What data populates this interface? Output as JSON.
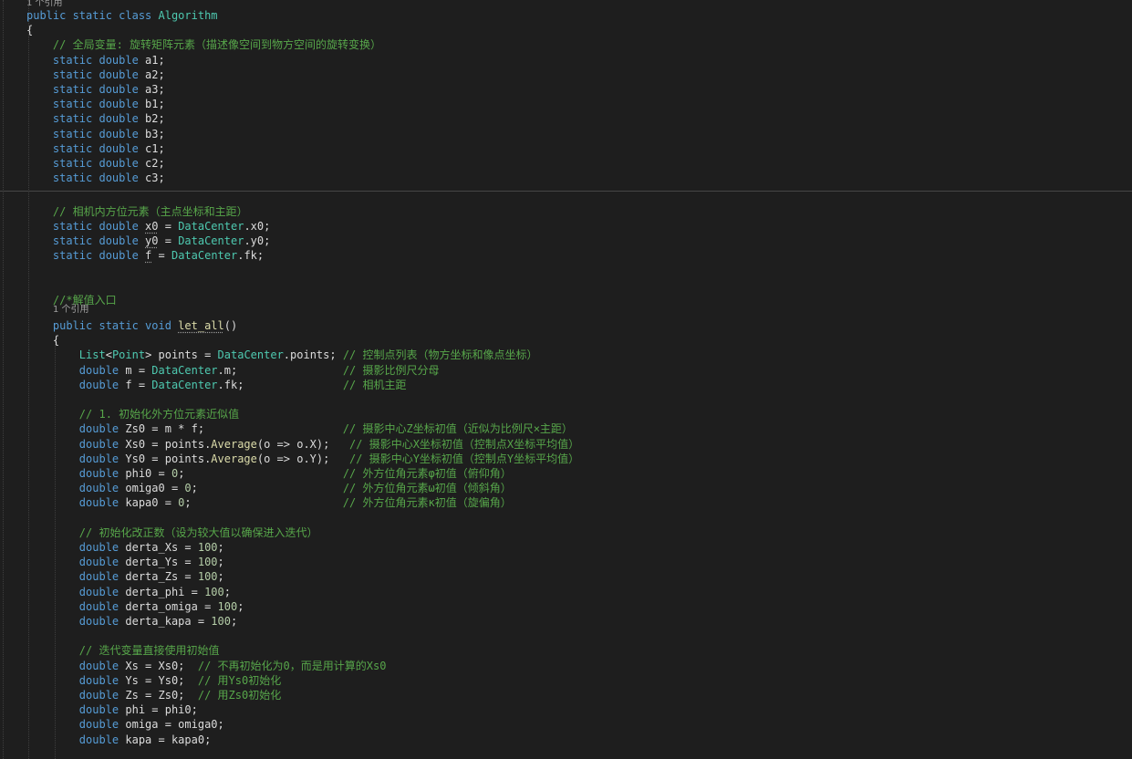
{
  "code_lens": {
    "class_refs": "1 个引用",
    "method_refs": "1 个引用"
  },
  "lines": [
    [
      {
        "t": "public static class ",
        "c": "kw"
      },
      {
        "t": "Algorithm",
        "c": "ty"
      }
    ],
    [
      {
        "t": "{",
        "c": "pl"
      }
    ],
    [
      {
        "t": "    // 全局变量: 旋转矩阵元素（描述像空间到物方空间的旋转变换）",
        "c": "cm"
      }
    ],
    [
      {
        "t": "    static double ",
        "c": "kw"
      },
      {
        "t": "a1;",
        "c": "pl"
      }
    ],
    [
      {
        "t": "    static double ",
        "c": "kw"
      },
      {
        "t": "a2;",
        "c": "pl"
      }
    ],
    [
      {
        "t": "    static double ",
        "c": "kw"
      },
      {
        "t": "a3;",
        "c": "pl"
      }
    ],
    [
      {
        "t": "    static double ",
        "c": "kw"
      },
      {
        "t": "b1;",
        "c": "pl"
      }
    ],
    [
      {
        "t": "    static double ",
        "c": "kw"
      },
      {
        "t": "b2;",
        "c": "pl"
      }
    ],
    [
      {
        "t": "    static double ",
        "c": "kw"
      },
      {
        "t": "b3;",
        "c": "pl"
      }
    ],
    [
      {
        "t": "    static double ",
        "c": "kw"
      },
      {
        "t": "c1;",
        "c": "pl"
      }
    ],
    [
      {
        "t": "    static double ",
        "c": "kw"
      },
      {
        "t": "c2;",
        "c": "pl"
      }
    ],
    [
      {
        "t": "    static double ",
        "c": "kw"
      },
      {
        "t": "c3;",
        "c": "pl"
      }
    ],
    [],
    [
      {
        "t": "    // 相机内方位元素（主点坐标和主距）",
        "c": "cm"
      }
    ],
    [
      {
        "t": "    static double ",
        "c": "kw"
      },
      {
        "t": "x0",
        "c": "pl",
        "u": 1
      },
      {
        "t": " = ",
        "c": "pl"
      },
      {
        "t": "DataCenter",
        "c": "ty"
      },
      {
        "t": ".x0;",
        "c": "pl"
      }
    ],
    [
      {
        "t": "    static double ",
        "c": "kw"
      },
      {
        "t": "y0",
        "c": "pl",
        "u": 1
      },
      {
        "t": " = ",
        "c": "pl"
      },
      {
        "t": "DataCenter",
        "c": "ty"
      },
      {
        "t": ".y0;",
        "c": "pl"
      }
    ],
    [
      {
        "t": "    static double ",
        "c": "kw"
      },
      {
        "t": "f",
        "c": "pl",
        "u": 1
      },
      {
        "t": " = ",
        "c": "pl"
      },
      {
        "t": "DataCenter",
        "c": "ty"
      },
      {
        "t": ".fk;",
        "c": "pl"
      }
    ],
    [],
    [],
    [
      {
        "t": "    //*解值入口",
        "c": "cm"
      }
    ],
    [
      {
        "t": "    public static void ",
        "c": "kw"
      },
      {
        "t": "let_all",
        "c": "mt",
        "u": 1
      },
      {
        "t": "()",
        "c": "pl"
      }
    ],
    [
      {
        "t": "    {",
        "c": "pl"
      }
    ],
    [
      {
        "t": "        List",
        "c": "ty"
      },
      {
        "t": "<",
        "c": "pl"
      },
      {
        "t": "Point",
        "c": "ty"
      },
      {
        "t": "> points = ",
        "c": "pl"
      },
      {
        "t": "DataCenter",
        "c": "ty"
      },
      {
        "t": ".points; ",
        "c": "pl"
      },
      {
        "t": "// 控制点列表（物方坐标和像点坐标）",
        "c": "cm"
      }
    ],
    [
      {
        "t": "        double ",
        "c": "kw"
      },
      {
        "t": "m = ",
        "c": "pl"
      },
      {
        "t": "DataCenter",
        "c": "ty"
      },
      {
        "t": ".m;                ",
        "c": "pl"
      },
      {
        "t": "// 摄影比例尺分母",
        "c": "cm"
      }
    ],
    [
      {
        "t": "        double ",
        "c": "kw"
      },
      {
        "t": "f = ",
        "c": "pl"
      },
      {
        "t": "DataCenter",
        "c": "ty"
      },
      {
        "t": ".fk;               ",
        "c": "pl"
      },
      {
        "t": "// 相机主距",
        "c": "cm"
      }
    ],
    [],
    [
      {
        "t": "        // 1. 初始化外方位元素近似值",
        "c": "cm"
      }
    ],
    [
      {
        "t": "        double ",
        "c": "kw"
      },
      {
        "t": "Zs0 = m * f;                     ",
        "c": "pl"
      },
      {
        "t": "// 摄影中心Z坐标初值（近似为比例尺×主距）",
        "c": "cm"
      }
    ],
    [
      {
        "t": "        double ",
        "c": "kw"
      },
      {
        "t": "Xs0 = points.",
        "c": "pl"
      },
      {
        "t": "Average",
        "c": "mt"
      },
      {
        "t": "(o => o.X);   ",
        "c": "pl"
      },
      {
        "t": "// 摄影中心X坐标初值（控制点X坐标平均值）",
        "c": "cm"
      }
    ],
    [
      {
        "t": "        double ",
        "c": "kw"
      },
      {
        "t": "Ys0 = points.",
        "c": "pl"
      },
      {
        "t": "Average",
        "c": "mt"
      },
      {
        "t": "(o => o.Y);   ",
        "c": "pl"
      },
      {
        "t": "// 摄影中心Y坐标初值（控制点Y坐标平均值）",
        "c": "cm"
      }
    ],
    [
      {
        "t": "        double ",
        "c": "kw"
      },
      {
        "t": "phi0 = ",
        "c": "pl"
      },
      {
        "t": "0",
        "c": "nm"
      },
      {
        "t": ";                        ",
        "c": "pl"
      },
      {
        "t": "// 外方位角元素φ初值（俯仰角）",
        "c": "cm"
      }
    ],
    [
      {
        "t": "        double ",
        "c": "kw"
      },
      {
        "t": "omiga0 = ",
        "c": "pl"
      },
      {
        "t": "0",
        "c": "nm"
      },
      {
        "t": ";                      ",
        "c": "pl"
      },
      {
        "t": "// 外方位角元素ω初值（倾斜角）",
        "c": "cm"
      }
    ],
    [
      {
        "t": "        double ",
        "c": "kw"
      },
      {
        "t": "kapa0 = ",
        "c": "pl"
      },
      {
        "t": "0",
        "c": "nm"
      },
      {
        "t": ";                       ",
        "c": "pl"
      },
      {
        "t": "// 外方位角元素κ初值（旋偏角）",
        "c": "cm"
      }
    ],
    [],
    [
      {
        "t": "        // 初始化改正数（设为较大值以确保进入迭代）",
        "c": "cm"
      }
    ],
    [
      {
        "t": "        double ",
        "c": "kw"
      },
      {
        "t": "derta_Xs = ",
        "c": "pl"
      },
      {
        "t": "100",
        "c": "nm"
      },
      {
        "t": ";",
        "c": "pl"
      }
    ],
    [
      {
        "t": "        double ",
        "c": "kw"
      },
      {
        "t": "derta_Ys = ",
        "c": "pl"
      },
      {
        "t": "100",
        "c": "nm"
      },
      {
        "t": ";",
        "c": "pl"
      }
    ],
    [
      {
        "t": "        double ",
        "c": "kw"
      },
      {
        "t": "derta_Zs = ",
        "c": "pl"
      },
      {
        "t": "100",
        "c": "nm"
      },
      {
        "t": ";",
        "c": "pl"
      }
    ],
    [
      {
        "t": "        double ",
        "c": "kw"
      },
      {
        "t": "derta_phi = ",
        "c": "pl"
      },
      {
        "t": "100",
        "c": "nm"
      },
      {
        "t": ";",
        "c": "pl"
      }
    ],
    [
      {
        "t": "        double ",
        "c": "kw"
      },
      {
        "t": "derta_omiga = ",
        "c": "pl"
      },
      {
        "t": "100",
        "c": "nm"
      },
      {
        "t": ";",
        "c": "pl"
      }
    ],
    [
      {
        "t": "        double ",
        "c": "kw"
      },
      {
        "t": "derta_kapa = ",
        "c": "pl"
      },
      {
        "t": "100",
        "c": "nm"
      },
      {
        "t": ";",
        "c": "pl"
      }
    ],
    [],
    [
      {
        "t": "        // 迭代变量直接使用初始值",
        "c": "cm"
      }
    ],
    [
      {
        "t": "        double ",
        "c": "kw"
      },
      {
        "t": "Xs = Xs0;  ",
        "c": "pl"
      },
      {
        "t": "// 不再初始化为0，而是用计算的Xs0",
        "c": "cm"
      }
    ],
    [
      {
        "t": "        double ",
        "c": "kw"
      },
      {
        "t": "Ys = Ys0;  ",
        "c": "pl"
      },
      {
        "t": "// 用Ys0初始化",
        "c": "cm"
      }
    ],
    [
      {
        "t": "        double ",
        "c": "kw"
      },
      {
        "t": "Zs = Zs0;  ",
        "c": "pl"
      },
      {
        "t": "// 用Zs0初始化",
        "c": "cm"
      }
    ],
    [
      {
        "t": "        double ",
        "c": "kw"
      },
      {
        "t": "phi = phi0;",
        "c": "pl"
      }
    ],
    [
      {
        "t": "        double ",
        "c": "kw"
      },
      {
        "t": "omiga = omiga0;",
        "c": "pl"
      }
    ],
    [
      {
        "t": "        double ",
        "c": "kw"
      },
      {
        "t": "kapa = kapa0;",
        "c": "pl"
      }
    ]
  ]
}
